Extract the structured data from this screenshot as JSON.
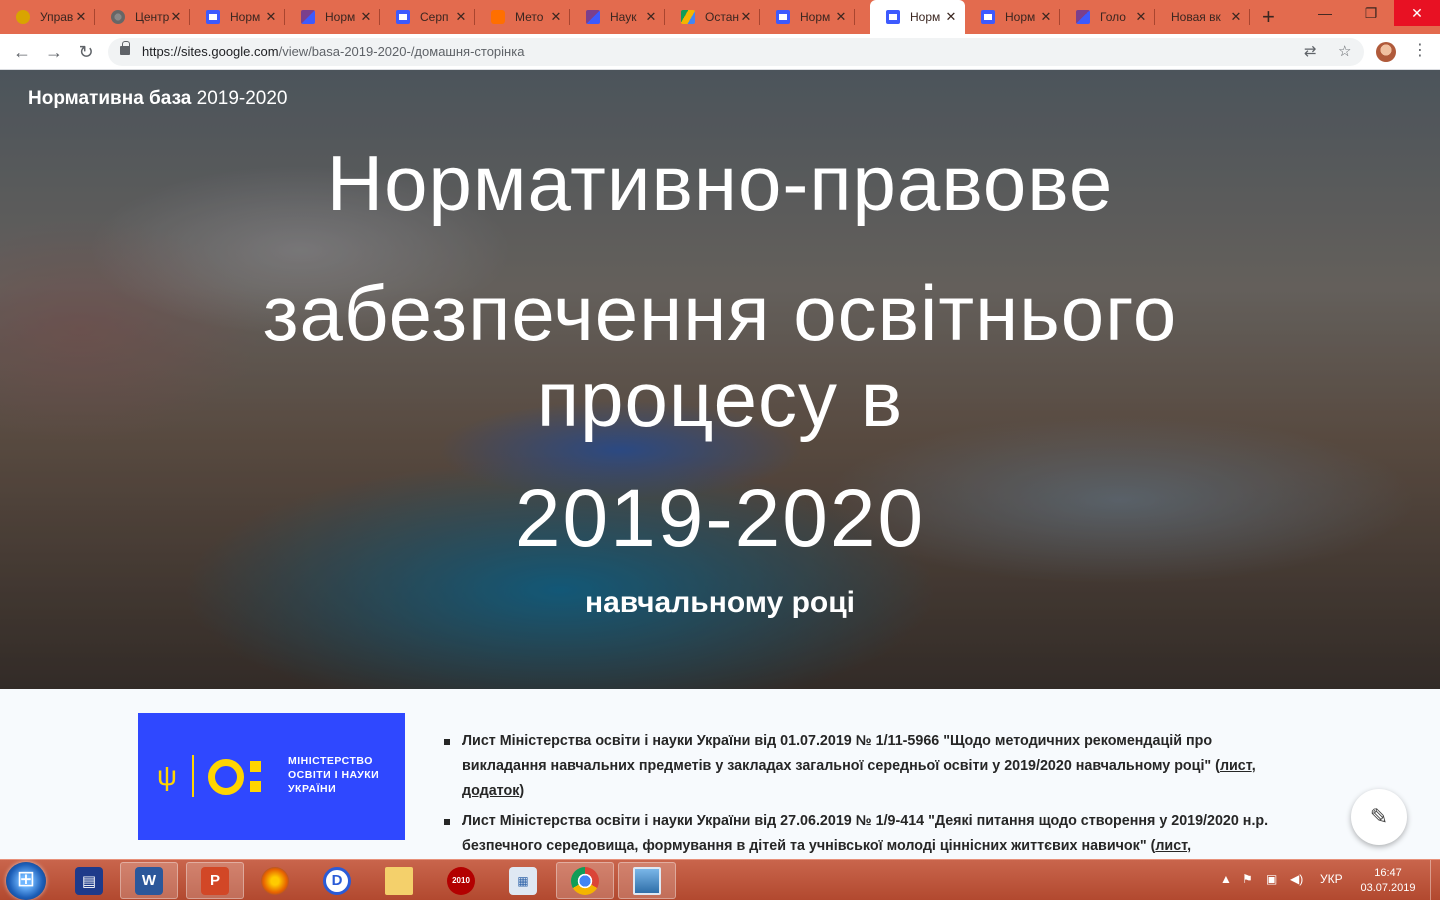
{
  "tabs": [
    {
      "title": "Управ",
      "icon": "shield-icon"
    },
    {
      "title": "Центр",
      "icon": "globe-icon"
    },
    {
      "title": "Норм",
      "icon": "sites-icon"
    },
    {
      "title": "Норм",
      "icon": "doc-icon"
    },
    {
      "title": "Серп",
      "icon": "sites-icon"
    },
    {
      "title": "Мето",
      "icon": "blogger-icon"
    },
    {
      "title": "Наук",
      "icon": "doc-icon"
    },
    {
      "title": "Остан",
      "icon": "drive-icon"
    },
    {
      "title": "Норм",
      "icon": "sites-icon"
    },
    {
      "title": "Норм",
      "icon": "sites-icon",
      "active": true
    },
    {
      "title": "Норм",
      "icon": "sites-icon"
    },
    {
      "title": "Голо",
      "icon": "doc-icon"
    },
    {
      "title": "Новая вк",
      "icon": ""
    }
  ],
  "address": {
    "url_host": "https://sites.google.com",
    "url_path": "/view/basa-2019-2020-/домашня-сторінка"
  },
  "site": {
    "title_bold": "Нормативна база",
    "title_rest": "2019-2020"
  },
  "hero": {
    "line1": "Нормативно-правове",
    "line2": "забезпечення освітнього",
    "line3": "процесу в",
    "year": "2019-2020",
    "subline": "навчальному році"
  },
  "logo": {
    "line1": "МІНІСТЕРСТВО",
    "line2": "ОСВІТИ І НАУКИ",
    "line3": "УКРАЇНИ"
  },
  "news": [
    {
      "text": "Лист Міністерства освіти і науки України від 01.07.2019 № 1/11-5966 \"Щодо методичних рекомендацій про викладання навчальних предметів у закладах загальної середньої освіти у 2019/2020 навчальному році\" (",
      "link1": "лист",
      "between": ", ",
      "link2": "додаток",
      "after": ")"
    },
    {
      "text": "Лист Міністерства освіти і науки України від 27.06.2019 № 1/9-414 \"Деякі питання щодо створення у 2019/2020 н.р. безпечного середовища, формування в дітей та учнівської молоді ціннісних життєвих навичок\" (",
      "link1": "лист",
      "between": ",",
      "link2": "",
      "after": ""
    }
  ],
  "taskbar": {
    "language": "УКР",
    "time": "16:47",
    "date": "03.07.2019"
  },
  "colors": {
    "tabstrip": "#e36b4e",
    "taskbar": "#b2492f",
    "logo_bg": "#2f48ff",
    "logo_accent": "#ffd500"
  }
}
